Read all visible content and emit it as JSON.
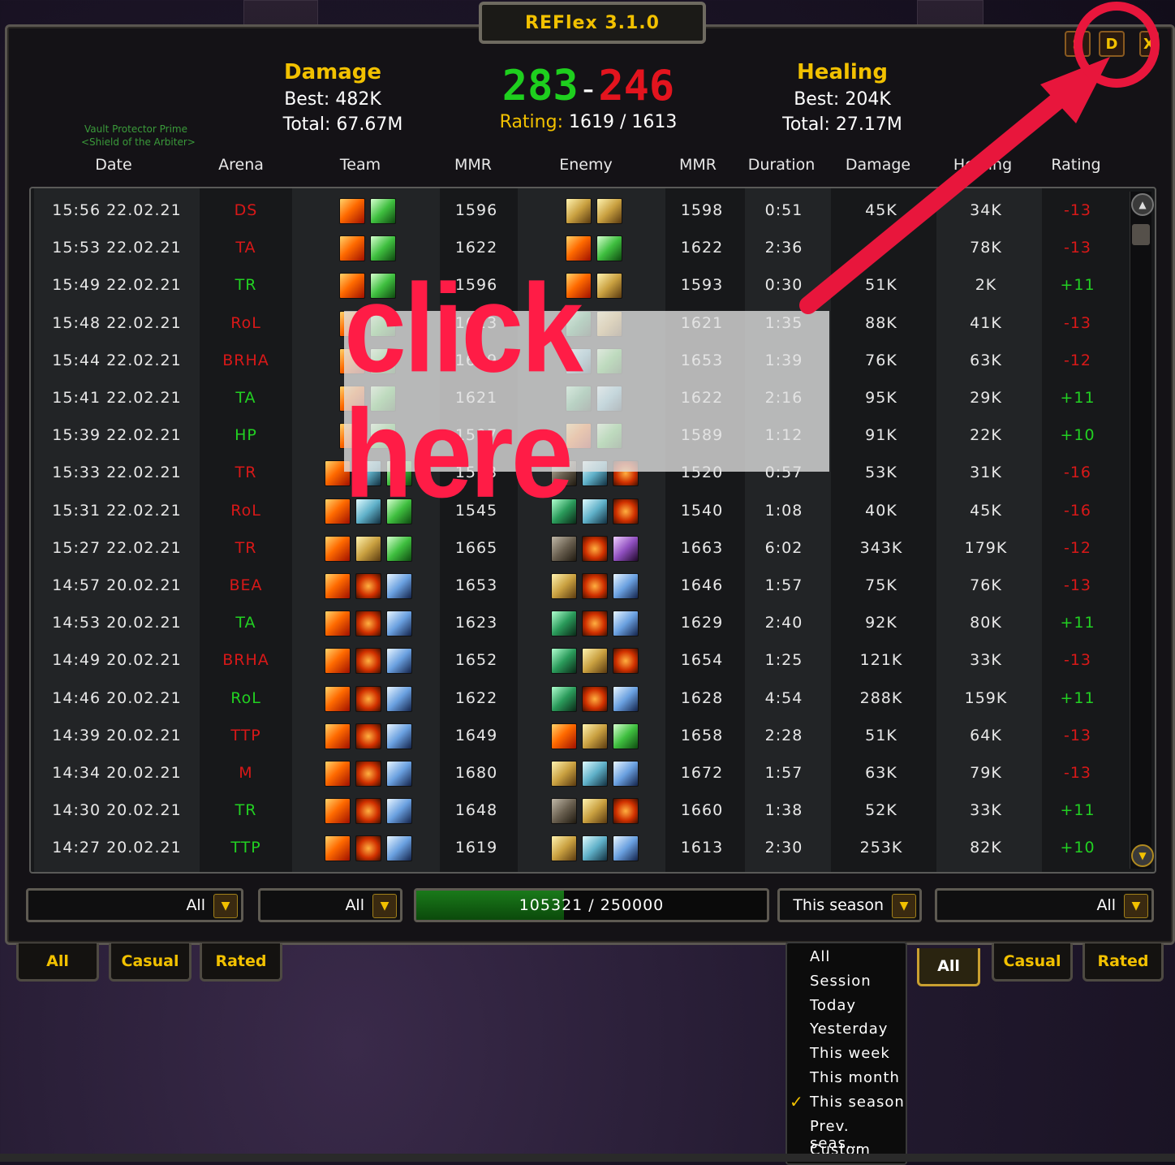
{
  "app": {
    "title": "REFlex 3.1.0"
  },
  "npc_labels": [
    "Vault Protector Prime",
    "<Shield of the Arbiter>"
  ],
  "top_buttons": {
    "s": "S",
    "d": "D",
    "x": "X"
  },
  "damage": {
    "title": "Damage",
    "best": "Best: 482K",
    "total": "Total: 67.67M"
  },
  "healing": {
    "title": "Healing",
    "best": "Best: 204K",
    "total": "Total: 27.17M"
  },
  "score": {
    "wins": "283",
    "sep": "-",
    "losses": "246",
    "rating_label": "Rating:",
    "rating_value": "1619 / 1613"
  },
  "columns": [
    "Date",
    "Arena",
    "Team",
    "MMR",
    "Enemy",
    "MMR",
    "Duration",
    "Damage",
    "Healing",
    "Rating"
  ],
  "colors": {
    "win": "#22d022",
    "loss": "#d81818",
    "gold": "#f2c100",
    "annotation": "#ff1c46"
  },
  "rows": [
    {
      "date": "15:56 22.02.21",
      "arena": "DS",
      "win": false,
      "team": [
        "fire",
        "leaf"
      ],
      "mmr": "1596",
      "enemy": [
        "holy",
        "holy"
      ],
      "emmr": "1598",
      "dur": "0:51",
      "dmg": "45K",
      "heal": "34K",
      "rating": "-13"
    },
    {
      "date": "15:53 22.02.21",
      "arena": "TA",
      "win": false,
      "team": [
        "fire",
        "leaf"
      ],
      "mmr": "1622",
      "enemy": [
        "fire",
        "leaf"
      ],
      "emmr": "1622",
      "dur": "2:36",
      "dmg": "",
      "heal": "78K",
      "rating": "-13"
    },
    {
      "date": "15:49 22.02.21",
      "arena": "TR",
      "win": true,
      "team": [
        "fire",
        "leaf"
      ],
      "mmr": "1596",
      "enemy": [
        "fire",
        "holy"
      ],
      "emmr": "1593",
      "dur": "0:30",
      "dmg": "51K",
      "heal": "2K",
      "rating": "+11"
    },
    {
      "date": "15:48 22.02.21",
      "arena": "RoL",
      "win": false,
      "team": [
        "fire",
        "leaf"
      ],
      "mmr": "1623",
      "enemy": [
        "poison",
        "holy"
      ],
      "emmr": "1621",
      "dur": "1:35",
      "dmg": "88K",
      "heal": "41K",
      "rating": "-13"
    },
    {
      "date": "15:44 22.02.21",
      "arena": "BRHA",
      "win": false,
      "team": [
        "fire",
        "leaf"
      ],
      "mmr": "1649",
      "enemy": [
        "frost",
        "leaf"
      ],
      "emmr": "1653",
      "dur": "1:39",
      "dmg": "76K",
      "heal": "63K",
      "rating": "-12"
    },
    {
      "date": "15:41 22.02.21",
      "arena": "TA",
      "win": true,
      "team": [
        "fire",
        "leaf"
      ],
      "mmr": "1621",
      "enemy": [
        "poison",
        "frost"
      ],
      "emmr": "1622",
      "dur": "2:16",
      "dmg": "95K",
      "heal": "29K",
      "rating": "+11"
    },
    {
      "date": "15:39 22.02.21",
      "arena": "HP",
      "win": true,
      "team": [
        "fire",
        "leaf"
      ],
      "mmr": "1597",
      "enemy": [
        "fire",
        "leaf"
      ],
      "emmr": "1589",
      "dur": "1:12",
      "dmg": "91K",
      "heal": "22K",
      "rating": "+10"
    },
    {
      "date": "15:33 22.02.21",
      "arena": "TR",
      "win": false,
      "team": [
        "fire",
        "frost",
        "leaf"
      ],
      "mmr": "1513",
      "enemy": [
        "stone",
        "frost",
        "lava"
      ],
      "emmr": "1520",
      "dur": "0:57",
      "dmg": "53K",
      "heal": "31K",
      "rating": "-16"
    },
    {
      "date": "15:31 22.02.21",
      "arena": "RoL",
      "win": false,
      "team": [
        "fire",
        "frost",
        "leaf"
      ],
      "mmr": "1545",
      "enemy": [
        "poison",
        "frost",
        "lava"
      ],
      "emmr": "1540",
      "dur": "1:08",
      "dmg": "40K",
      "heal": "45K",
      "rating": "-16"
    },
    {
      "date": "15:27 22.02.21",
      "arena": "TR",
      "win": false,
      "team": [
        "fire",
        "holy",
        "leaf"
      ],
      "mmr": "1665",
      "enemy": [
        "stone",
        "lava",
        "void"
      ],
      "emmr": "1663",
      "dur": "6:02",
      "dmg": "343K",
      "heal": "179K",
      "rating": "-12"
    },
    {
      "date": "14:57 20.02.21",
      "arena": "BEA",
      "win": false,
      "team": [
        "fire",
        "lava",
        "sword"
      ],
      "mmr": "1653",
      "enemy": [
        "holy",
        "lava",
        "sword"
      ],
      "emmr": "1646",
      "dur": "1:57",
      "dmg": "75K",
      "heal": "76K",
      "rating": "-13"
    },
    {
      "date": "14:53 20.02.21",
      "arena": "TA",
      "win": true,
      "team": [
        "fire",
        "lava",
        "sword"
      ],
      "mmr": "1623",
      "enemy": [
        "poison",
        "lava",
        "sword"
      ],
      "emmr": "1629",
      "dur": "2:40",
      "dmg": "92K",
      "heal": "80K",
      "rating": "+11"
    },
    {
      "date": "14:49 20.02.21",
      "arena": "BRHA",
      "win": false,
      "team": [
        "fire",
        "lava",
        "sword"
      ],
      "mmr": "1652",
      "enemy": [
        "poison",
        "holy",
        "lava"
      ],
      "emmr": "1654",
      "dur": "1:25",
      "dmg": "121K",
      "heal": "33K",
      "rating": "-13"
    },
    {
      "date": "14:46 20.02.21",
      "arena": "RoL",
      "win": true,
      "team": [
        "fire",
        "lava",
        "sword"
      ],
      "mmr": "1622",
      "enemy": [
        "poison",
        "lava",
        "sword"
      ],
      "emmr": "1628",
      "dur": "4:54",
      "dmg": "288K",
      "heal": "159K",
      "rating": "+11"
    },
    {
      "date": "14:39 20.02.21",
      "arena": "TTP",
      "win": false,
      "team": [
        "fire",
        "lava",
        "sword"
      ],
      "mmr": "1649",
      "enemy": [
        "fire",
        "holy",
        "leaf"
      ],
      "emmr": "1658",
      "dur": "2:28",
      "dmg": "51K",
      "heal": "64K",
      "rating": "-13"
    },
    {
      "date": "14:34 20.02.21",
      "arena": "M",
      "win": false,
      "team": [
        "fire",
        "lava",
        "sword"
      ],
      "mmr": "1680",
      "enemy": [
        "holy",
        "frost",
        "sword"
      ],
      "emmr": "1672",
      "dur": "1:57",
      "dmg": "63K",
      "heal": "79K",
      "rating": "-13"
    },
    {
      "date": "14:30 20.02.21",
      "arena": "TR",
      "win": true,
      "team": [
        "fire",
        "lava",
        "sword"
      ],
      "mmr": "1648",
      "enemy": [
        "stone",
        "holy",
        "lava"
      ],
      "emmr": "1660",
      "dur": "1:38",
      "dmg": "52K",
      "heal": "33K",
      "rating": "+11"
    },
    {
      "date": "14:27 20.02.21",
      "arena": "TTP",
      "win": true,
      "team": [
        "fire",
        "lava",
        "sword"
      ],
      "mmr": "1619",
      "enemy": [
        "holy",
        "frost",
        "sword"
      ],
      "emmr": "1613",
      "dur": "2:30",
      "dmg": "253K",
      "heal": "82K",
      "rating": "+10"
    }
  ],
  "filters": {
    "filter1": "All",
    "filter2": "All",
    "progress": {
      "text": "105321 / 250000",
      "value": 105321,
      "max": 250000
    },
    "period": "This season",
    "filter4": "All"
  },
  "tabs_left": [
    "All",
    "Casual",
    "Rated"
  ],
  "tabs_right": [
    "All",
    "Casual",
    "Rated"
  ],
  "period_menu": {
    "items": [
      "All",
      "Session",
      "Today",
      "Yesterday",
      "This week",
      "This month",
      "This season",
      "Prev. seas...",
      "Custom"
    ],
    "checked_index": 6,
    "check_glyph": "✓"
  },
  "annotation": {
    "text": "click here"
  }
}
